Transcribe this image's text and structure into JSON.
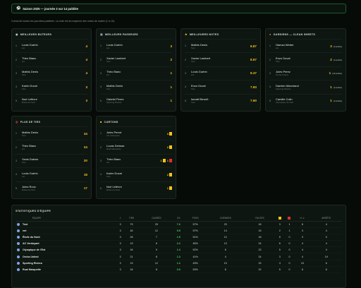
{
  "banner": {
    "icon": "soccer-ball-icon",
    "text": "Saison 2025 — journée 3 sur 14 publiée"
  },
  "description": "Cumul de toutes les journées publiées. La note est la moyenne des notes de match (1 à 10).",
  "colors": {
    "gold": "#f2c41b",
    "green": "#4cd36a",
    "yellow_card": "#f5c518",
    "red_card": "#e2302f",
    "border": "#1f5a2f"
  },
  "cards": {
    "scorers": {
      "title": "MEILLEURS BUTEURS",
      "icon": "ball-icon",
      "rows": [
        {
          "rank": "1",
          "player": "Louis Guérin",
          "team": "ent",
          "value": "4"
        },
        {
          "rank": "2",
          "player": "Théo Blanc",
          "team": "ent",
          "value": "4"
        },
        {
          "rank": "3",
          "player": "Mathis Denis",
          "team": "Test",
          "value": "4"
        },
        {
          "rank": "4",
          "player": "Karim Duval",
          "team": "Test",
          "value": "3"
        },
        {
          "rank": "5",
          "player": "Noé Lefèvre",
          "team": "Étoile du Nord",
          "value": "3"
        }
      ]
    },
    "passers": {
      "title": "MEILLEURS PASSEURS",
      "icon": "assist-icon",
      "rows": [
        {
          "rank": "1",
          "player": "Louis Guérin",
          "team": "ent",
          "value": "3"
        },
        {
          "rank": "2",
          "player": "Xavier Lambert",
          "team": "Test",
          "value": "2"
        },
        {
          "rank": "3",
          "player": "Théo Blanc",
          "team": "ent",
          "value": "1"
        },
        {
          "rank": "4",
          "player": "Mathis Denis",
          "team": "Test",
          "value": "1"
        },
        {
          "rank": "5",
          "player": "Gabriel Perez",
          "team": "Sporting Riviera",
          "value": "1"
        }
      ]
    },
    "ratings": {
      "title": "MEILLEURES NOTES",
      "icon": "star-icon",
      "rows": [
        {
          "rank": "1",
          "player": "Mathis Denis",
          "team": "Test",
          "value": "8.87"
        },
        {
          "rank": "2",
          "player": "Xavier Lambert",
          "team": "Test",
          "value": "8.67"
        },
        {
          "rank": "3",
          "player": "Louis Guérin",
          "team": "ent",
          "value": "8.37"
        },
        {
          "rank": "4",
          "player": "Enzo Duval",
          "team": "Test",
          "value": "7.83"
        },
        {
          "rank": "5",
          "player": "Ismaël Benoît",
          "team": "Test",
          "value": "7.60"
        }
      ]
    },
    "keepers": {
      "title": "GARDIENS — CLEAN SHEETS",
      "icon": "glove-icon",
      "rows": [
        {
          "rank": "1",
          "player": "Hamza Weber",
          "team": "ent",
          "value": "3",
          "note": "(4 arrêts)"
        },
        {
          "rank": "2",
          "player": "Enzo Duval",
          "team": "Test",
          "value": "2",
          "note": "(4 arrêts)"
        },
        {
          "rank": "3",
          "player": "Jules Perez",
          "team": "Orcha United",
          "value": "1",
          "note": "(19 arrêts)"
        },
        {
          "rank": "4",
          "player": "Damien Marchand",
          "team": "Sporting Riviera",
          "value": "1",
          "note": "(4 arrêts)"
        },
        {
          "rank": "5",
          "player": "Camille Colin",
          "team": "Olympique de l'Est",
          "value": "1",
          "note": "(4 arrêts)"
        }
      ]
    },
    "shots": {
      "title": "PLUS DE TIRS",
      "icon": "target-icon",
      "rows": [
        {
          "rank": "1",
          "player": "Mathis Denis",
          "team": "Test",
          "value": "34"
        },
        {
          "rank": "2",
          "player": "Théo Blanc",
          "team": "ent",
          "value": "24"
        },
        {
          "rank": "3",
          "player": "Yanis Dubois",
          "team": "Test",
          "value": "20"
        },
        {
          "rank": "4",
          "player": "Louis Guérin",
          "team": "ent",
          "value": "18"
        },
        {
          "rank": "5",
          "player": "Jules Roux",
          "team": "Étoile du Nord",
          "value": "17"
        }
      ]
    },
    "discipline": {
      "title": "CARTONS",
      "icon": "card-icon",
      "rows": [
        {
          "rank": "1",
          "player": "Jules Perrot",
          "team": "AC Verdoyant",
          "yellow": "3",
          "red": ""
        },
        {
          "rank": "2",
          "player": "Lucas Delmas",
          "team": "Rual Marquette",
          "yellow": "2",
          "red": ""
        },
        {
          "rank": "3",
          "player": "Théo Blanc",
          "team": "ent",
          "yellow": "1",
          "red": "1"
        },
        {
          "rank": "4",
          "player": "Karim Duval",
          "team": "Test",
          "yellow": "2",
          "red": ""
        },
        {
          "rank": "5",
          "player": "Noé Lefèvre",
          "team": "Étoile du Nord",
          "yellow": "1",
          "red": ""
        }
      ]
    }
  },
  "team_stats": {
    "title": "STATISTIQUES D'ÉQUIPE",
    "headers": [
      "ÉQUIPE",
      "J",
      "TIRS",
      "CADRÉS",
      "XG",
      "POSS",
      "CORNERS",
      "FAUTES",
      "",
      "",
      "H.-J.",
      "ARRÊTS"
    ],
    "rows": [
      [
        "Test",
        "3",
        "79",
        "29",
        "7.6",
        "57%",
        "23",
        "18",
        "3",
        "1",
        "6",
        "4"
      ],
      [
        "ent",
        "3",
        "45",
        "12",
        "5.5",
        "57%",
        "14",
        "15",
        "2",
        "1",
        "3",
        "4"
      ],
      [
        "Étoile du Nord",
        "3",
        "26",
        "7",
        "1.5",
        "51%",
        "12",
        "18",
        "5",
        "0",
        "3",
        "0"
      ],
      [
        "AC Verdoyant",
        "3",
        "19",
        "6",
        "2.2",
        "45%",
        "13",
        "24",
        "6",
        "0",
        "4",
        "4"
      ],
      [
        "Olympique de l'Est",
        "3",
        "16",
        "9",
        "1.4",
        "52%",
        "6",
        "23",
        "5",
        "0",
        "4",
        "4"
      ],
      [
        "Orcha United",
        "3",
        "21",
        "8",
        "1.3",
        "41%",
        "4",
        "24",
        "3",
        "0",
        "4",
        "19"
      ],
      [
        "Sporting Riviera",
        "3",
        "19",
        "12",
        "1.2",
        "49%",
        "10",
        "15",
        "4",
        "0",
        "10",
        "6"
      ],
      [
        "Rual Marquette",
        "3",
        "16",
        "8",
        "0.9",
        "53%",
        "6",
        "22",
        "5",
        "0",
        "6",
        "6"
      ]
    ]
  }
}
